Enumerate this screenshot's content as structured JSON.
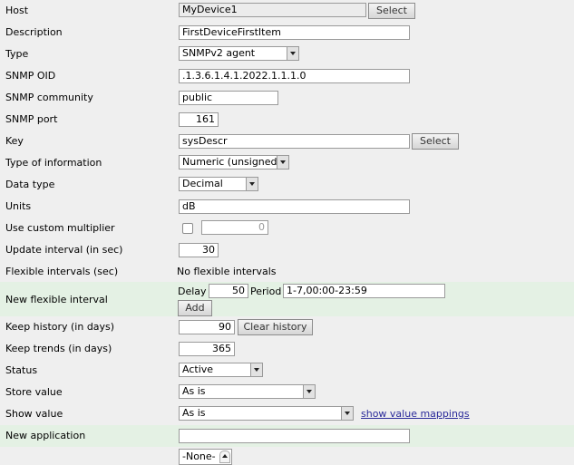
{
  "form": {
    "host": {
      "label": "Host",
      "value": "MyDevice1",
      "select_label": "Select"
    },
    "description": {
      "label": "Description",
      "value": "FirstDeviceFirstItem"
    },
    "type": {
      "label": "Type",
      "value": "SNMPv2 agent"
    },
    "snmp_oid": {
      "label": "SNMP OID",
      "value": ".1.3.6.1.4.1.2022.1.1.1.0"
    },
    "snmp_community": {
      "label": "SNMP community",
      "value": "public"
    },
    "snmp_port": {
      "label": "SNMP port",
      "value": "161"
    },
    "key": {
      "label": "Key",
      "value": "sysDescr",
      "select_label": "Select"
    },
    "type_of_information": {
      "label": "Type of information",
      "value": "Numeric (unsigned)"
    },
    "data_type": {
      "label": "Data type",
      "value": "Decimal"
    },
    "units": {
      "label": "Units",
      "value": "dB"
    },
    "custom_multiplier": {
      "label": "Use custom multiplier",
      "value": "0",
      "checked": false
    },
    "update_interval": {
      "label": "Update interval (in sec)",
      "value": "30"
    },
    "flexible_intervals": {
      "label": "Flexible intervals (sec)",
      "value": "No flexible intervals"
    },
    "new_flexible_interval": {
      "label": "New flexible interval",
      "delay_label": "Delay",
      "delay_value": "50",
      "period_label": "Period",
      "period_value": "1-7,00:00-23:59",
      "add_label": "Add"
    },
    "keep_history": {
      "label": "Keep history (in days)",
      "value": "90",
      "clear_label": "Clear history"
    },
    "keep_trends": {
      "label": "Keep trends (in days)",
      "value": "365"
    },
    "status": {
      "label": "Status",
      "value": "Active"
    },
    "store_value": {
      "label": "Store value",
      "value": "As is"
    },
    "show_value": {
      "label": "Show value",
      "value": "As is",
      "mappings_link": "show value mappings"
    },
    "new_application": {
      "label": "New application",
      "value": ""
    },
    "applications": {
      "first_option": "-None-"
    }
  },
  "colors": {
    "background": "#efefef",
    "highlight_row": "#e4f1e4",
    "link": "#2a2a9a"
  }
}
